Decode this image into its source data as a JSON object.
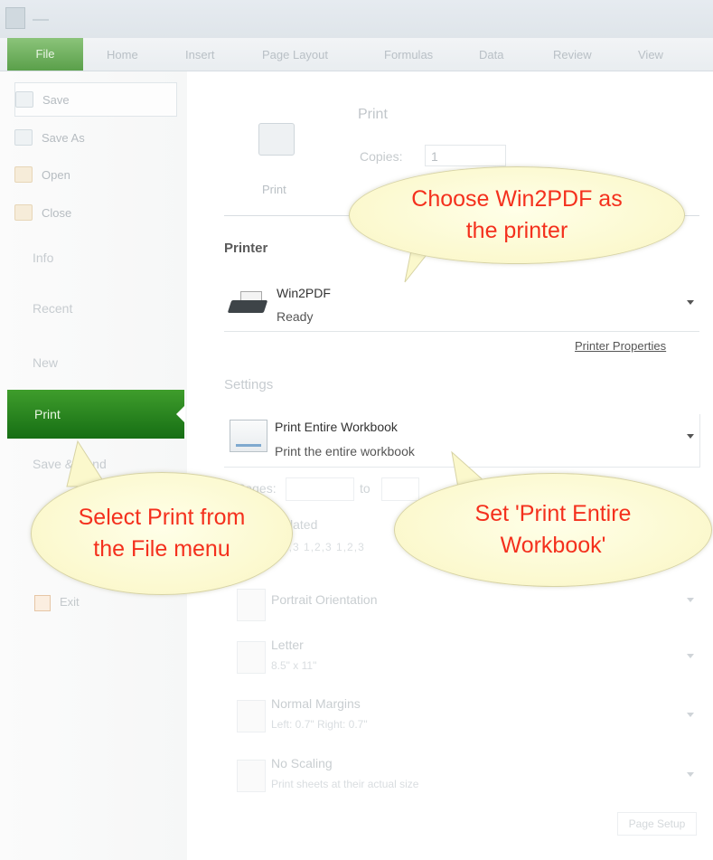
{
  "ribbon": {
    "tabs": [
      "File",
      "Home",
      "Insert",
      "Page Layout",
      "Formulas",
      "Data",
      "Review",
      "View"
    ]
  },
  "leftnav": {
    "save": "Save",
    "save_as": "Save As",
    "open": "Open",
    "close": "Close",
    "info": "Info",
    "recent": "Recent",
    "new": "New",
    "print": "Print",
    "save_send": "Save & Send",
    "exit": "Exit"
  },
  "print": {
    "heading": "Print",
    "button_label": "Print",
    "copies_label": "Copies:",
    "copies_value": "1"
  },
  "printer": {
    "section_title": "Printer",
    "name": "Win2PDF",
    "status": "Ready",
    "properties_link": "Printer Properties"
  },
  "settings": {
    "section_title": "Settings",
    "what_title": "Print Entire Workbook",
    "what_subtitle": "Print the entire workbook",
    "pages_label": "Pages:",
    "pages_to": "to",
    "collated_title": "Collated",
    "collated_sub": "1,2,3   1,2,3   1,2,3",
    "orientation": "Portrait Orientation",
    "paper_title": "Letter",
    "paper_sub": "8.5\" x 11\"",
    "margins_title": "Normal Margins",
    "margins_sub": "Left: 0.7\"   Right: 0.7\"",
    "scaling_title": "No Scaling",
    "scaling_sub": "Print sheets at their actual size",
    "page_setup": "Page Setup"
  },
  "callouts": {
    "printer": "Choose Win2PDF as the printer",
    "file_menu": "Select Print from the File menu",
    "workbook": "Set 'Print Entire Workbook'"
  },
  "colors": {
    "file_tab": "#5aa04a",
    "print_nav": "#1f7a1c",
    "callout_text": "#f4301d",
    "callout_fill": "#fbf8cc"
  }
}
